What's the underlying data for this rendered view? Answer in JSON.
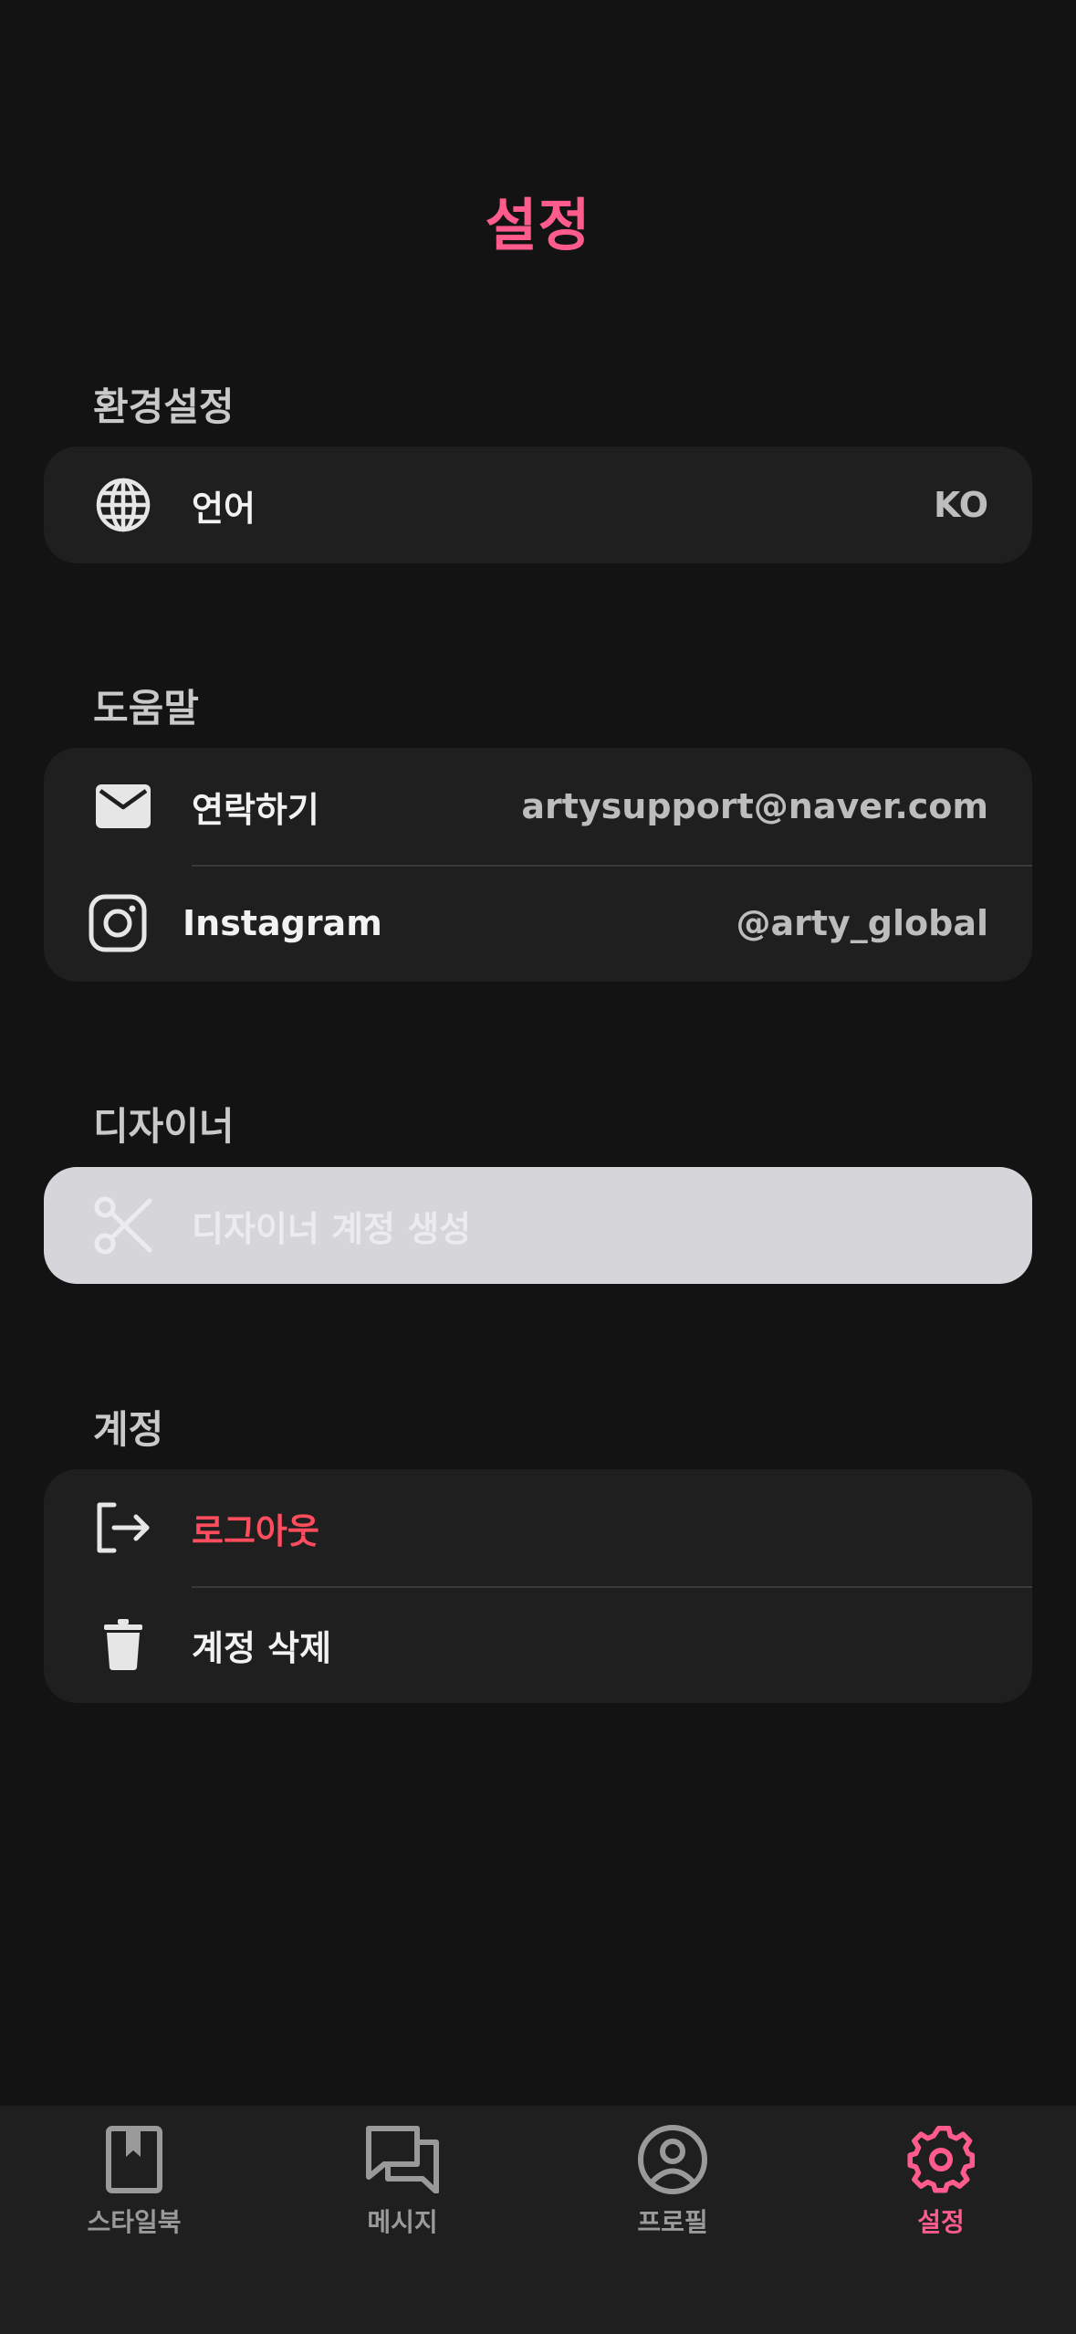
{
  "header": {
    "title": "설정"
  },
  "sections": {
    "preferences": {
      "title": "환경설정",
      "language_label": "언어",
      "language_value": "KO"
    },
    "help": {
      "title": "도움말",
      "contact_label": "연락하기",
      "contact_value": "artysupport@naver.com",
      "instagram_label": "Instagram",
      "instagram_value": "@arty_global"
    },
    "designer": {
      "title": "디자이너",
      "create_label": "디자이너 계정 생성"
    },
    "account": {
      "title": "계정",
      "logout_label": "로그아웃",
      "delete_label": "계정 삭제"
    }
  },
  "tabbar": {
    "items": [
      {
        "label": "스타일북",
        "icon": "stylebook-icon"
      },
      {
        "label": "메시지",
        "icon": "message-icon"
      },
      {
        "label": "프로필",
        "icon": "profile-icon"
      },
      {
        "label": "설정",
        "icon": "settings-icon"
      }
    ],
    "active_index": 3
  },
  "colors": {
    "accent": "#ff5c8d",
    "danger": "#ff4d5e",
    "background": "#131313",
    "card": "#1f1f1f"
  }
}
